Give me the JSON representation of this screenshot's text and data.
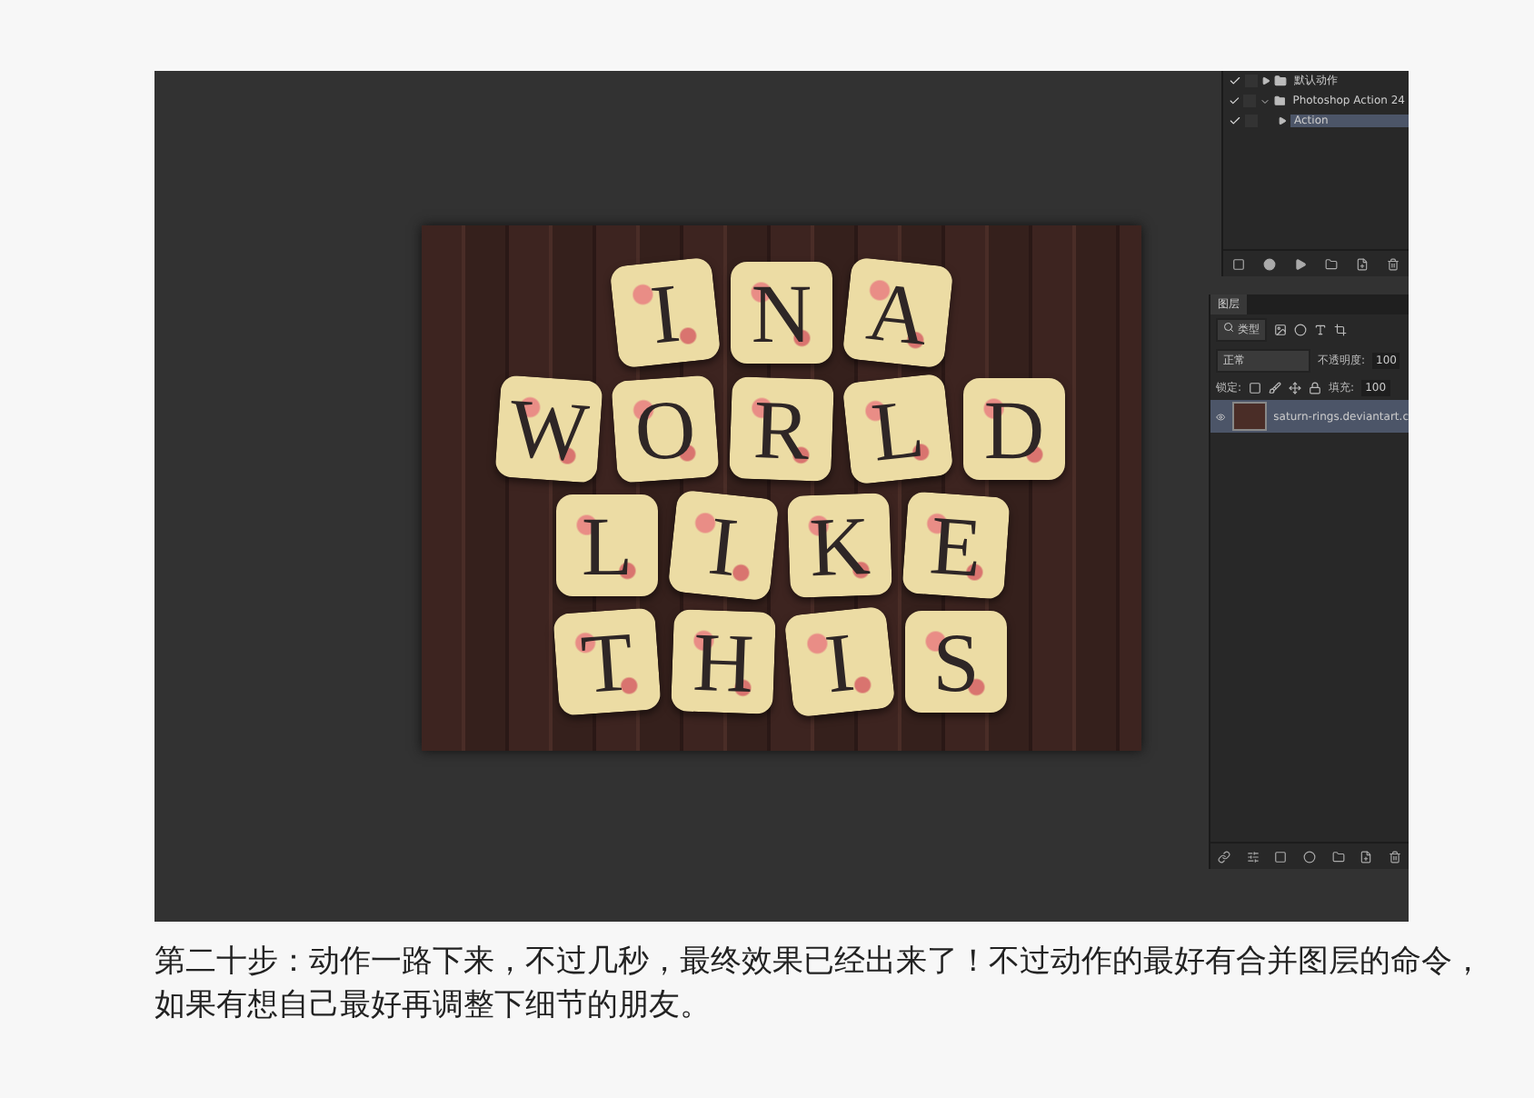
{
  "actions_panel": {
    "items": [
      {
        "label": "默认动作",
        "kind": "set",
        "expanded": false,
        "selected": false
      },
      {
        "label": "Photoshop Action 24",
        "kind": "set",
        "expanded": true,
        "selected": false
      },
      {
        "label": "Action",
        "kind": "action",
        "expanded": false,
        "selected": true
      }
    ]
  },
  "canvas": {
    "rows": [
      [
        "I",
        "N",
        "A"
      ],
      [
        "W",
        "O",
        "R",
        "L",
        "D"
      ],
      [
        "L",
        "I",
        "K",
        "E"
      ],
      [
        "T",
        "H",
        "I",
        "S"
      ]
    ]
  },
  "layers_panel": {
    "tab": "图层",
    "filter": "类型",
    "blend_mode": "正常",
    "opacity_label": "不透明度:",
    "opacity": "100",
    "lock_label": "锁定:",
    "fill_label": "填充:",
    "fill": "100",
    "layers": [
      {
        "name": "saturn-rings.deviantart.c",
        "visible": true,
        "selected": true
      }
    ]
  },
  "caption": "第二十步：动作一路下来，不过几秒，最终效果已经出来了！不过动作的最好有合并图层的命令，如果有想自己最好再调整下细节的朋友。"
}
